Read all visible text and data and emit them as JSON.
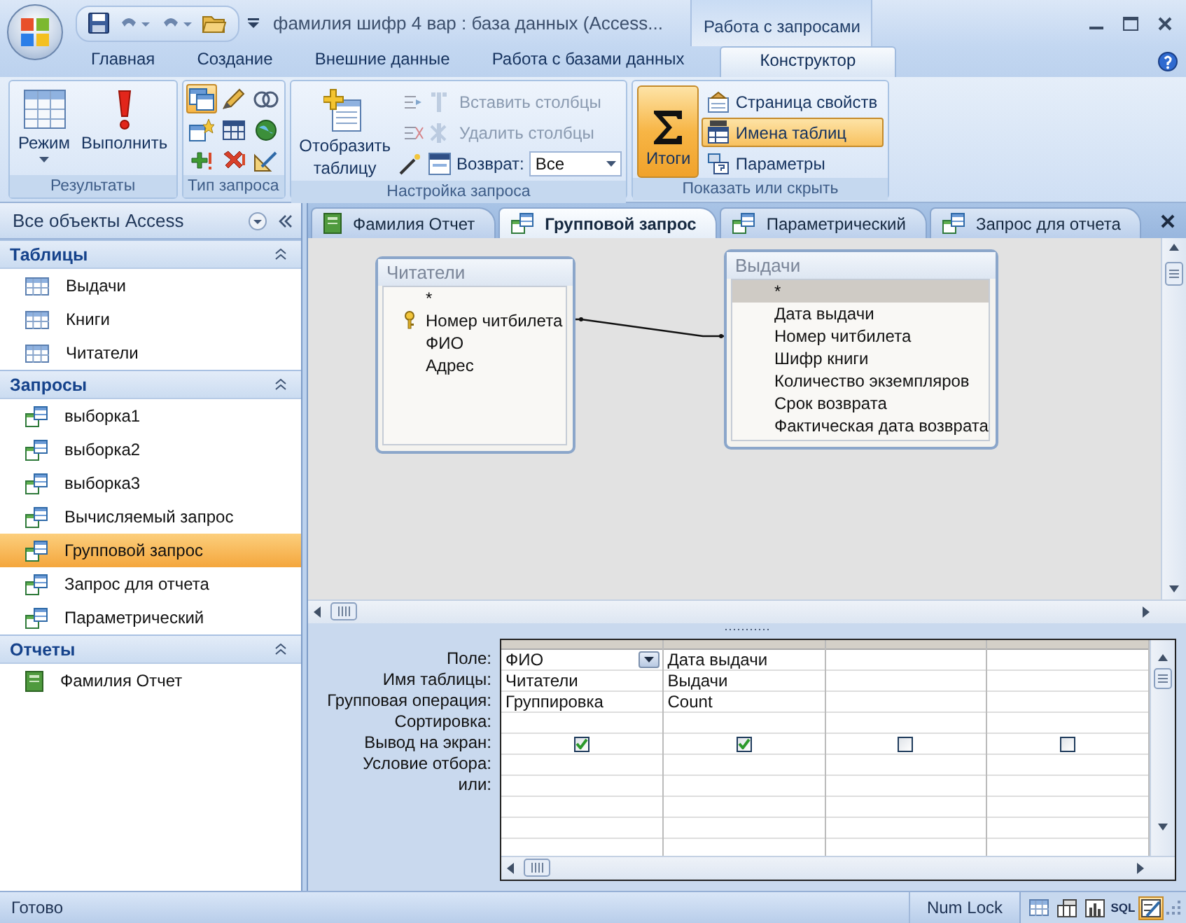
{
  "window": {
    "title": "фамилия шифр 4 вар : база данных (Access...",
    "context_tab": "Работа с запросами"
  },
  "ribbon_tabs": [
    {
      "label": "Главная",
      "selected": false
    },
    {
      "label": "Создание",
      "selected": false
    },
    {
      "label": "Внешние данные",
      "selected": false
    },
    {
      "label": "Работа с базами данных",
      "selected": false
    },
    {
      "label": "Конструктор",
      "selected": true
    }
  ],
  "ribbon_groups": [
    {
      "kind": "results",
      "label": "Результаты",
      "buttons": [
        {
          "label": "Режим"
        },
        {
          "label": "Выполнить"
        }
      ]
    },
    {
      "kind": "query_type",
      "label": "Тип запроса",
      "tools": [
        {
          "selected": true
        },
        {
          "selected": false
        },
        {
          "selected": false
        },
        {
          "selected": false
        },
        {
          "selected": false
        },
        {
          "selected": false
        },
        {
          "selected": false
        },
        {
          "selected": false
        },
        {
          "selected": false
        }
      ]
    },
    {
      "kind": "setup",
      "label": "Настройка запроса",
      "show_table": [
        "Отобразить",
        "таблицу"
      ],
      "commands": [
        {
          "label": "Вставить столбцы",
          "disabled": true
        },
        {
          "label": "Удалить столбцы",
          "disabled": true
        }
      ],
      "return": {
        "label": "Возврат:",
        "value": "Все"
      }
    },
    {
      "kind": "show_hide",
      "label": "Показать или скрыть",
      "totals": {
        "label": "Итоги",
        "on": true
      },
      "commands": [
        {
          "label": "Страница свойств",
          "on": false
        },
        {
          "label": "Имена таблиц",
          "on": true
        },
        {
          "label": "Параметры",
          "on": false
        }
      ]
    }
  ],
  "nav": {
    "title": "Все объекты Access",
    "groups": [
      {
        "label": "Таблицы",
        "kind": "table",
        "expanded": true,
        "items": [
          {
            "label": "Выдачи",
            "selected": false
          },
          {
            "label": "Книги",
            "selected": false
          },
          {
            "label": "Читатели",
            "selected": false
          }
        ]
      },
      {
        "label": "Запросы",
        "kind": "query",
        "expanded": true,
        "items": [
          {
            "label": "выборка1",
            "selected": false
          },
          {
            "label": "выборка2",
            "selected": false
          },
          {
            "label": "выборка3",
            "selected": false
          },
          {
            "label": "Вычисляемый запрос",
            "selected": false
          },
          {
            "label": "Групповой запрос",
            "selected": true
          },
          {
            "label": "Запрос для отчета",
            "selected": false
          },
          {
            "label": "Параметрический",
            "selected": false
          }
        ]
      },
      {
        "label": "Отчеты",
        "kind": "report",
        "expanded": true,
        "items": [
          {
            "label": "Фамилия Отчет",
            "selected": false
          }
        ]
      }
    ]
  },
  "doc_tabs": [
    {
      "label": "Фамилия Отчет",
      "kind": "report",
      "selected": false
    },
    {
      "label": "Групповой запрос",
      "kind": "query",
      "selected": true
    },
    {
      "label": "Параметрический",
      "kind": "query",
      "selected": false
    },
    {
      "label": "Запрос для отчета",
      "kind": "query",
      "selected": false
    }
  ],
  "canvas": {
    "tables": [
      {
        "title": "Читатели",
        "fields": [
          {
            "name": "*",
            "key": false,
            "selected": false
          },
          {
            "name": "Номер читбилета",
            "key": true,
            "selected": false
          },
          {
            "name": "ФИО",
            "key": false,
            "selected": false
          },
          {
            "name": "Адрес",
            "key": false,
            "selected": false
          }
        ]
      },
      {
        "title": "Выдачи",
        "fields": [
          {
            "name": "*",
            "key": false,
            "selected": true
          },
          {
            "name": "Дата выдачи",
            "key": false,
            "selected": false
          },
          {
            "name": "Номер читбилета",
            "key": false,
            "selected": false
          },
          {
            "name": "Шифр книги",
            "key": false,
            "selected": false
          },
          {
            "name": "Количество экземпляров",
            "key": false,
            "selected": false
          },
          {
            "name": "Срок возврата",
            "key": false,
            "selected": false
          },
          {
            "name": "Фактическая дата возврата",
            "key": false,
            "selected": false
          }
        ]
      }
    ]
  },
  "grid": {
    "row_labels": [
      "Поле:",
      "Имя таблицы:",
      "Групповая операция:",
      "Сортировка:",
      "Вывод на экран:",
      "Условие отбора:",
      "или:"
    ],
    "columns": [
      {
        "field": "ФИО",
        "table": "Читатели",
        "total": "Группировка",
        "show": true,
        "selected": true
      },
      {
        "field": "Дата выдачи",
        "table": "Выдачи",
        "total": "Count",
        "show": true,
        "selected": false
      },
      {
        "show": false,
        "selected": false
      },
      {
        "show": false,
        "selected": false
      }
    ]
  },
  "status_bar": {
    "text": "Готово",
    "num_lock": "Num Lock",
    "view_buttons": [
      {
        "kind": "datasheet",
        "selected": false
      },
      {
        "kind": "pivot_table",
        "selected": false
      },
      {
        "kind": "pivot_chart",
        "selected": false
      },
      {
        "kind": "sql",
        "label": "SQL",
        "selected": false
      },
      {
        "kind": "design",
        "selected": true
      }
    ]
  }
}
